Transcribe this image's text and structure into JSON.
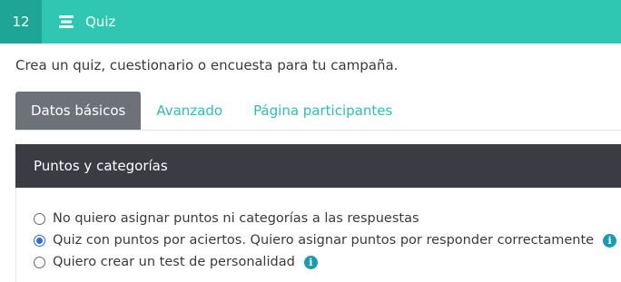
{
  "header": {
    "step_number": "12",
    "title": "Quiz",
    "icon": "quiz-list-icon"
  },
  "subtitle": "Crea un quiz, cuestionario o encuesta para tu campaña.",
  "tabs": [
    {
      "label": "Datos básicos",
      "active": true
    },
    {
      "label": "Avanzado",
      "active": false
    },
    {
      "label": "Página participantes",
      "active": false
    }
  ],
  "panel": {
    "title": "Puntos y categorías",
    "options": [
      {
        "label": "No quiero asignar puntos ni categorías a las respuestas",
        "checked": false,
        "info": false
      },
      {
        "label": "Quiz con puntos por aciertos. Quiero asignar puntos por responder correctamente",
        "checked": true,
        "info": true
      },
      {
        "label": "Quiero crear un test de personalidad",
        "checked": false,
        "info": true
      }
    ]
  },
  "colors": {
    "accent": "#2fc6b2",
    "badge": "#1fa596",
    "active_tab": "#6d7279",
    "panel_header": "#3b3b44",
    "info": "#1a9bb4",
    "radio_checked": "#2a6ed8"
  }
}
